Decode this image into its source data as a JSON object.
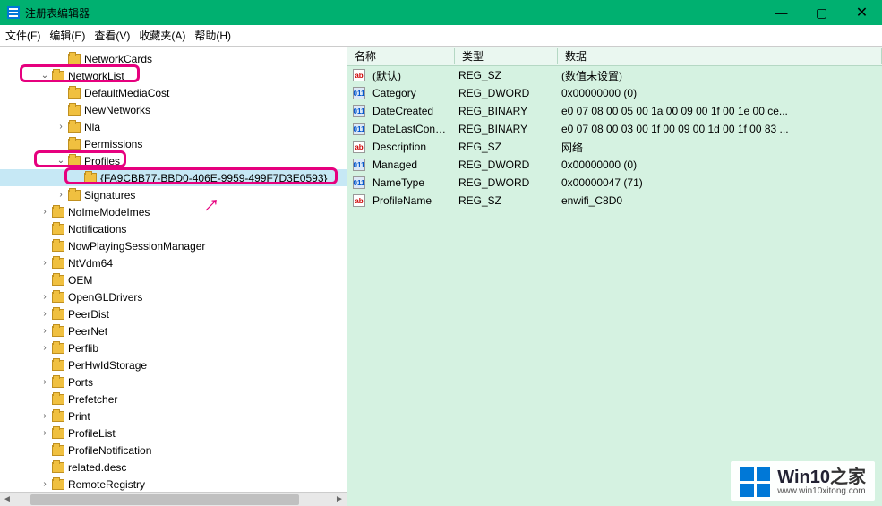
{
  "window": {
    "title": "注册表编辑器",
    "buttons": {
      "min": "—",
      "max": "▢",
      "close": "✕"
    }
  },
  "menu": {
    "file": "文件(F)",
    "edit": "编辑(E)",
    "view": "查看(V)",
    "fav": "收藏夹(A)",
    "help": "帮助(H)"
  },
  "tree": [
    {
      "indent": 3,
      "chev": "",
      "label": "NetworkCards"
    },
    {
      "indent": 2,
      "chev": "v",
      "label": "NetworkList",
      "box": 1
    },
    {
      "indent": 3,
      "chev": "",
      "label": "DefaultMediaCost"
    },
    {
      "indent": 3,
      "chev": "",
      "label": "NewNetworks"
    },
    {
      "indent": 3,
      "chev": ">",
      "label": "Nla"
    },
    {
      "indent": 3,
      "chev": "",
      "label": "Permissions"
    },
    {
      "indent": 3,
      "chev": "v",
      "label": "Profiles",
      "box": 2
    },
    {
      "indent": 4,
      "chev": "",
      "label": "{FA9CBB77-BBD0-406E-9959-499F7D3E0593}",
      "box": 3,
      "sel": true
    },
    {
      "indent": 3,
      "chev": ">",
      "label": "Signatures"
    },
    {
      "indent": 2,
      "chev": ">",
      "label": "NoImeModeImes"
    },
    {
      "indent": 2,
      "chev": "",
      "label": "Notifications"
    },
    {
      "indent": 2,
      "chev": "",
      "label": "NowPlayingSessionManager"
    },
    {
      "indent": 2,
      "chev": ">",
      "label": "NtVdm64"
    },
    {
      "indent": 2,
      "chev": "",
      "label": "OEM"
    },
    {
      "indent": 2,
      "chev": ">",
      "label": "OpenGLDrivers"
    },
    {
      "indent": 2,
      "chev": ">",
      "label": "PeerDist"
    },
    {
      "indent": 2,
      "chev": ">",
      "label": "PeerNet"
    },
    {
      "indent": 2,
      "chev": ">",
      "label": "Perflib"
    },
    {
      "indent": 2,
      "chev": "",
      "label": "PerHwIdStorage"
    },
    {
      "indent": 2,
      "chev": ">",
      "label": "Ports"
    },
    {
      "indent": 2,
      "chev": "",
      "label": "Prefetcher"
    },
    {
      "indent": 2,
      "chev": ">",
      "label": "Print"
    },
    {
      "indent": 2,
      "chev": ">",
      "label": "ProfileList"
    },
    {
      "indent": 2,
      "chev": "",
      "label": "ProfileNotification"
    },
    {
      "indent": 2,
      "chev": "",
      "label": "related.desc"
    },
    {
      "indent": 2,
      "chev": ">",
      "label": "RemoteRegistry"
    }
  ],
  "cols": {
    "name": "名称",
    "type": "类型",
    "data": "数据"
  },
  "rows": [
    {
      "icon": "ab",
      "name": "(默认)",
      "type": "REG_SZ",
      "data": "(数值未设置)"
    },
    {
      "icon": "bin",
      "name": "Category",
      "type": "REG_DWORD",
      "data": "0x00000000 (0)"
    },
    {
      "icon": "bin",
      "name": "DateCreated",
      "type": "REG_BINARY",
      "data": "e0 07 08 00 05 00 1a 00 09 00 1f 00 1e 00 ce..."
    },
    {
      "icon": "bin",
      "name": "DateLastConn...",
      "type": "REG_BINARY",
      "data": "e0 07 08 00 03 00 1f 00 09 00 1d 00 1f 00 83 ..."
    },
    {
      "icon": "ab",
      "name": "Description",
      "type": "REG_SZ",
      "data": "网络"
    },
    {
      "icon": "bin",
      "name": "Managed",
      "type": "REG_DWORD",
      "data": "0x00000000 (0)"
    },
    {
      "icon": "bin",
      "name": "NameType",
      "type": "REG_DWORD",
      "data": "0x00000047 (71)"
    },
    {
      "icon": "ab",
      "name": "ProfileName",
      "type": "REG_SZ",
      "data": "enwifi_C8D0"
    }
  ],
  "icontext": {
    "ab": "ab",
    "bin": "011"
  },
  "watermark": {
    "brand": "Win10",
    "suffix": "之家",
    "url": "www.win10xitong.com"
  }
}
